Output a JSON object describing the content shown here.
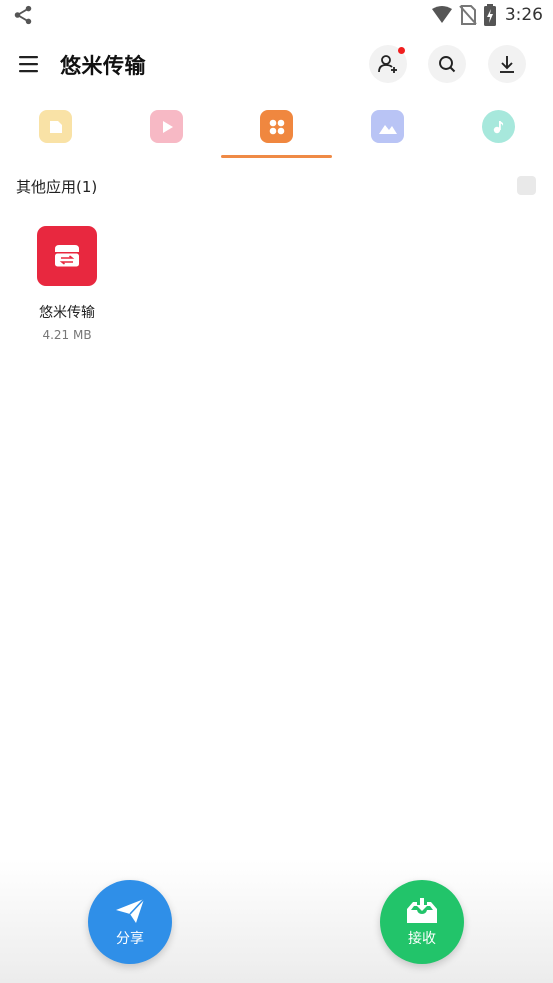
{
  "status_bar": {
    "time": "3:26",
    "icons": [
      "share-icon",
      "wifi-icon",
      "no-sim-icon",
      "battery-charging-icon"
    ]
  },
  "header": {
    "title": "悠米传输",
    "icons": [
      "menu-icon",
      "add-user-icon",
      "search-icon",
      "download-icon"
    ],
    "notification_dot_color": "#f01f1f"
  },
  "tabs": {
    "items": [
      {
        "icon": "file-icon",
        "color": "#f9e2a6"
      },
      {
        "icon": "video-icon",
        "color": "#f7b9c5"
      },
      {
        "icon": "app-icon",
        "color": "#f0873f"
      },
      {
        "icon": "image-icon",
        "color": "#b9c4f5"
      },
      {
        "icon": "music-icon",
        "color": "#a7e8dc"
      }
    ],
    "active_index": 2,
    "indicator_color": "#ef8a46"
  },
  "section": {
    "title": "其他应用(1)"
  },
  "apps": [
    {
      "name": "悠米传输",
      "size": "4.21 MB",
      "icon_color": "#e8283f"
    }
  ],
  "actions": {
    "share_label": "分享",
    "receive_label": "接收",
    "share_color": "#2f8fe8",
    "receive_color": "#22c46a"
  }
}
